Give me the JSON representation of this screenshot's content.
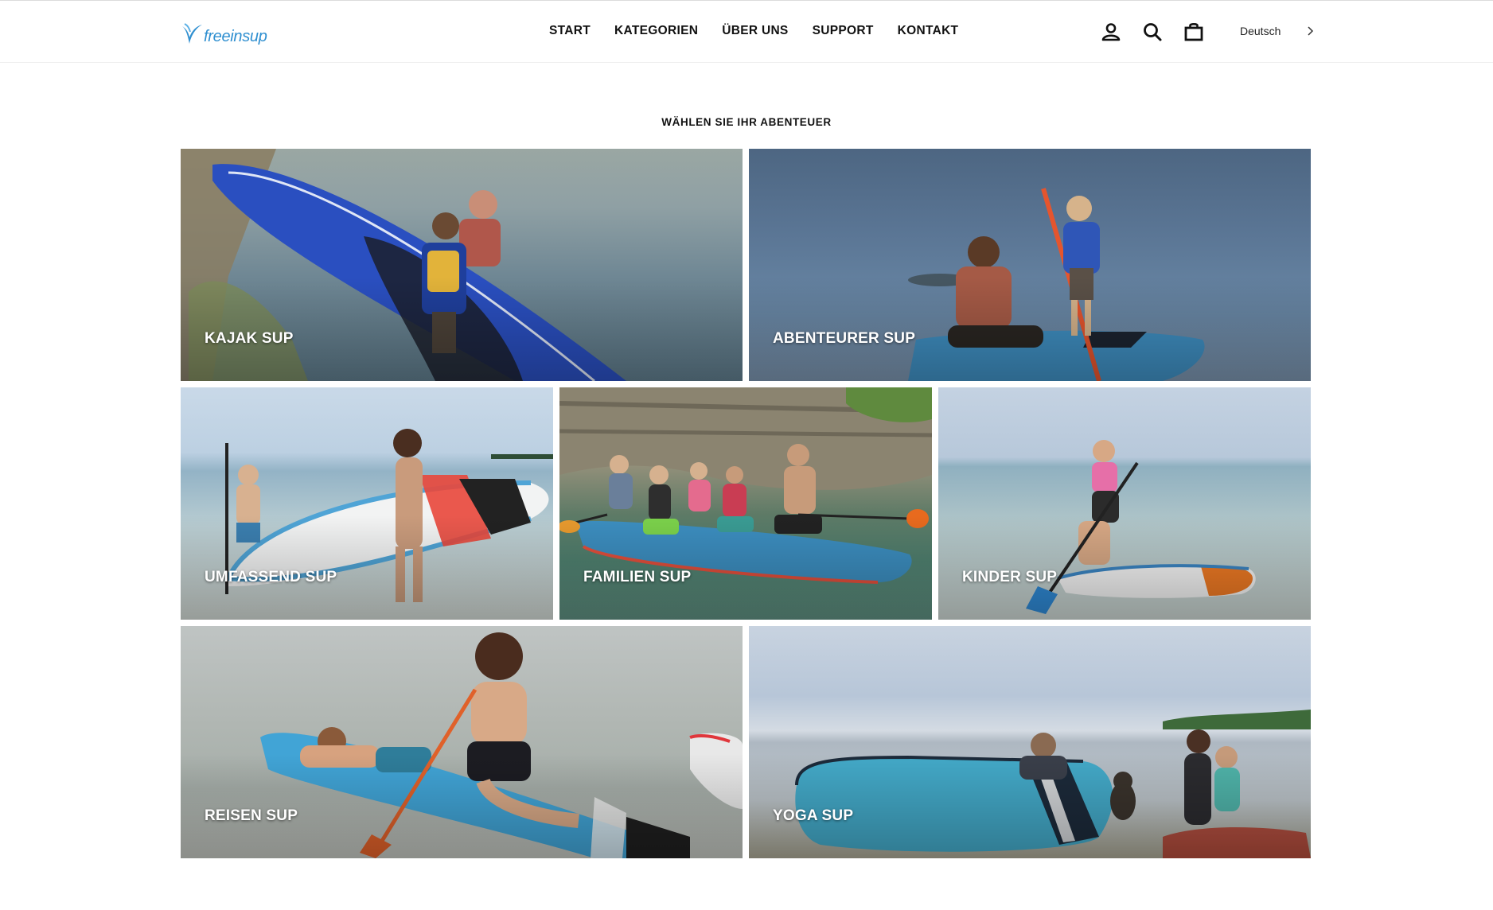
{
  "brand": {
    "name": "freeinsup",
    "logo_icon": "wave-logo-icon",
    "accent": "#2f8fd0"
  },
  "nav": {
    "items": [
      "START",
      "KATEGORIEN",
      "ÜBER UNS",
      "SUPPORT",
      "KONTAKT"
    ]
  },
  "header_icons": [
    "account-icon",
    "search-icon",
    "cart-icon"
  ],
  "language": {
    "current": "Deutsch"
  },
  "section": {
    "title": "WÄHLEN SIE IHR ABENTEUER",
    "tiles": [
      {
        "label": "KAJAK SUP"
      },
      {
        "label": "ABENTEURER SUP"
      },
      {
        "label": "UMFASSEND SUP"
      },
      {
        "label": "FAMILIEN SUP"
      },
      {
        "label": "KINDER SUP"
      },
      {
        "label": "REISEN SUP"
      },
      {
        "label": "YOGA SUP"
      }
    ]
  }
}
